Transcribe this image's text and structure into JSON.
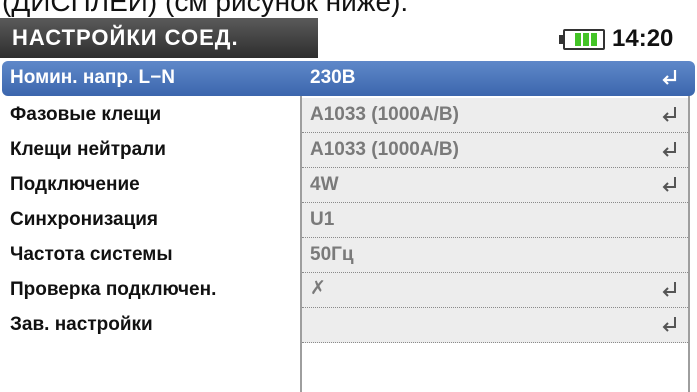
{
  "top_caption": "(ДИСПЛЕЙ) (см рисунок ниже):",
  "header": {
    "title": "НАСТРОЙКИ СОЕД.",
    "time": "14:20",
    "battery_color": "#43c326",
    "battery_icon": "battery-icon"
  },
  "rows": [
    {
      "label": "Номин. напр. L−N",
      "value": "230В",
      "enter": true,
      "selected": true
    },
    {
      "label": "Фазовые клещи",
      "value": "A1033 (1000A/В)",
      "enter": true
    },
    {
      "label": "Клещи нейтрали",
      "value": "A1033 (1000A/В)",
      "enter": true
    },
    {
      "label": "Подключение",
      "value": "4W",
      "enter": true
    },
    {
      "label": "Синхронизация",
      "value": "U1",
      "enter": false
    },
    {
      "label": "Частота системы",
      "value": "50Гц",
      "enter": false
    },
    {
      "label": "Проверка подключен.",
      "value": "✗",
      "enter": true,
      "status_icon": "red-cross-icon",
      "status_color": "#e01010"
    },
    {
      "label": "Зав. настройки",
      "value": "",
      "enter": true
    }
  ]
}
